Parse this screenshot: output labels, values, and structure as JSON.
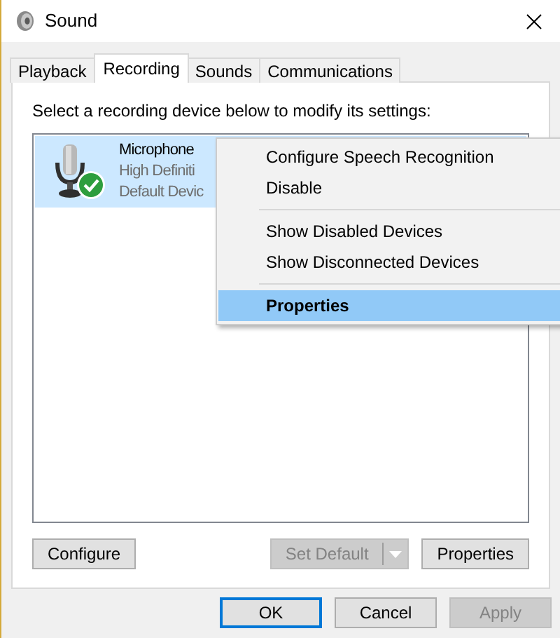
{
  "window": {
    "title": "Sound"
  },
  "tabs": [
    {
      "label": "Playback",
      "selected": false
    },
    {
      "label": "Recording",
      "selected": true
    },
    {
      "label": "Sounds",
      "selected": false
    },
    {
      "label": "Communications",
      "selected": false
    }
  ],
  "instruction": "Select a recording device below to modify its settings:",
  "devices": [
    {
      "name": "Microphone",
      "description": "High Definiti",
      "status": "Default Devic",
      "selected": true,
      "is_default": true
    }
  ],
  "context_menu": {
    "items": [
      {
        "kind": "item",
        "label": "Configure Speech Recognition",
        "selected": false,
        "default": false
      },
      {
        "kind": "item",
        "label": "Disable",
        "selected": false,
        "default": false
      },
      {
        "kind": "separator"
      },
      {
        "kind": "item",
        "label": "Show Disabled Devices",
        "selected": false,
        "default": false
      },
      {
        "kind": "item",
        "label": "Show Disconnected Devices",
        "selected": false,
        "default": false
      },
      {
        "kind": "separator"
      },
      {
        "kind": "item",
        "label": "Properties",
        "selected": true,
        "default": true
      }
    ]
  },
  "panel_buttons": [
    {
      "kind": "button",
      "label": "Configure",
      "disabled": false
    },
    {
      "kind": "split",
      "label": "Set Default",
      "disabled": true
    },
    {
      "kind": "button",
      "label": "Properties",
      "disabled": false
    }
  ],
  "dialog_buttons": [
    {
      "label": "OK",
      "focused": true,
      "disabled": false
    },
    {
      "label": "Cancel",
      "focused": false,
      "disabled": false
    },
    {
      "label": "Apply",
      "focused": false,
      "disabled": true
    }
  ]
}
